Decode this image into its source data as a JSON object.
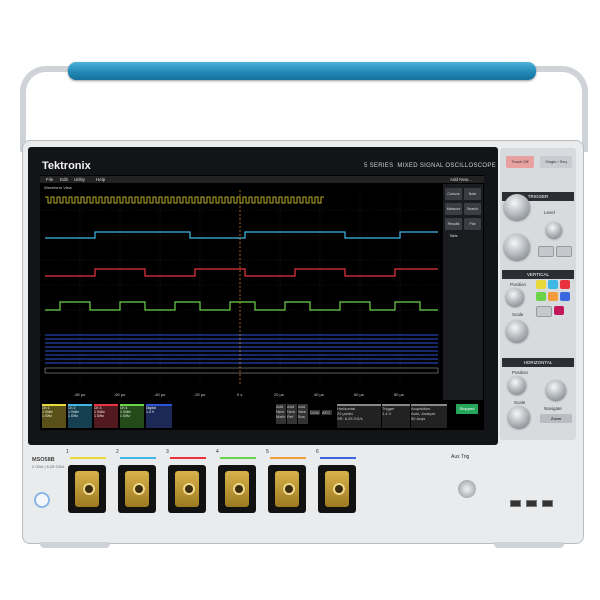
{
  "brand": "Tektronix",
  "series": "5 SERIES",
  "product_line": "MIXED SIGNAL OSCILLOSCOPE",
  "menu": [
    "File",
    "Edit",
    "Utility",
    "Help"
  ],
  "screen_tabs": {
    "waveform_view": "Waveform View",
    "add_new": "Add New..."
  },
  "right_buttons": [
    "Cursors",
    "Note",
    "Measure",
    "Search",
    "Results Table",
    "Plot"
  ],
  "time_labels": [
    "-80 µs",
    "-60 µs",
    "-40 µs",
    "-20 µs",
    "0 s",
    "20 µs",
    "40 µs",
    "60 µs",
    "80 µs"
  ],
  "channel_badges": [
    {
      "name": "Ch 1",
      "line1": "1 V/div",
      "line2": "1 MΩ",
      "line3": "1 GHz"
    },
    {
      "name": "Ch 2",
      "line1": "1 V/div",
      "line2": "1 MΩ",
      "line3": "1 GHz"
    },
    {
      "name": "Ch 3",
      "line1": "1 V/div",
      "line2": "1 MΩ",
      "line3": "1 GHz"
    },
    {
      "name": "Ch 4",
      "line1": "1 V/div",
      "line2": "1 MΩ",
      "line3": "1 GHz"
    },
    {
      "name": "Digital",
      "line1": "1.4 V",
      "line2": "",
      "line3": ""
    }
  ],
  "bottom_controls": [
    "Add New Math",
    "Add New Ref",
    "Add New Bus",
    "DVM",
    "AFG"
  ],
  "horizontal_box": {
    "title": "Horizontal",
    "line1": "20 µs/div",
    "line2": "SR: 6.25 GS/s",
    "line3": "RL: 1.25 Mpts"
  },
  "trigger_box": {
    "title": "Trigger",
    "line1": "1.4 V"
  },
  "acq_box": {
    "title": "Acquisition",
    "line1": "Auto, Analyze",
    "line2": "Sample: 8 bits",
    "line3": "50 Acqs"
  },
  "run_button": "Stopped",
  "front_panel": {
    "touch_off": "Touch Off",
    "single_seq": "Single / Seq",
    "trigger": "TRIGGER",
    "level": "Level",
    "vertical": "VERTICAL",
    "position": "Position",
    "scale": "Scale",
    "horizontal": "HORIZONTAL",
    "navigate": "Navigate",
    "zoom": "Zoom"
  },
  "model": "MSO58B",
  "model_sub": "2 GHz | 6.25 GS/s",
  "aux_trig": "Aux Trig",
  "probe_numbers": [
    "1",
    "2",
    "3",
    "4",
    "5",
    "6"
  ],
  "colors": {
    "ch1": "#e8d93a",
    "ch2": "#3fb8e6",
    "ch3": "#e8333f",
    "ch4": "#6bd34a",
    "digital": "#2b55d6",
    "handle": "#1f86b4"
  }
}
